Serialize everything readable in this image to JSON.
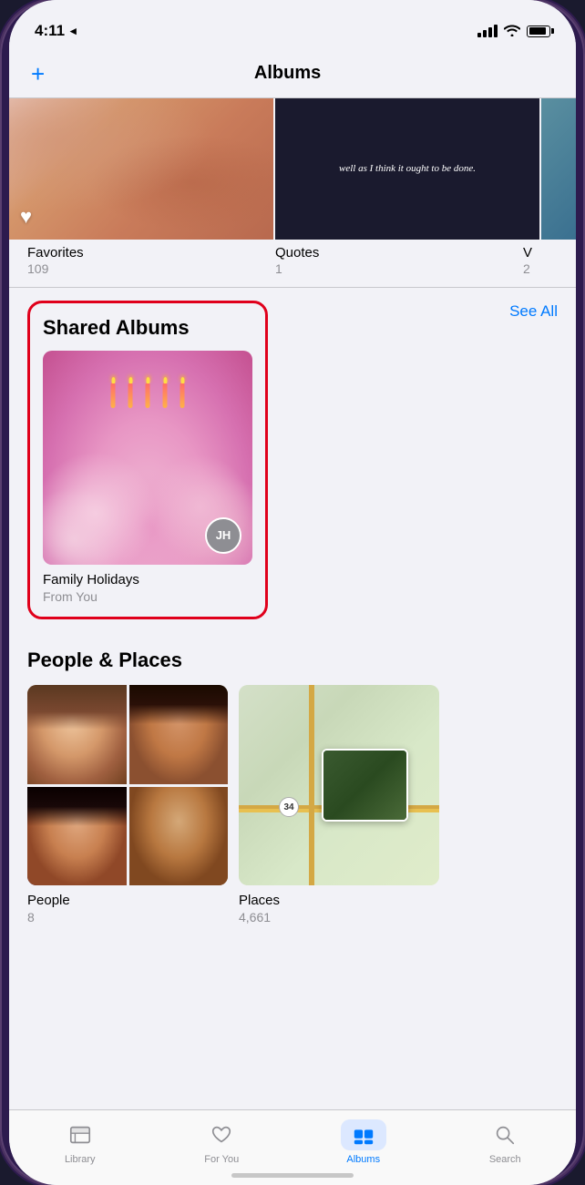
{
  "device": {
    "time": "4:11",
    "navigation_arrow": "◂"
  },
  "header": {
    "title": "Albums",
    "add_button": "+",
    "back_label": ""
  },
  "top_albums": [
    {
      "name": "Favorites",
      "count": "109",
      "type": "favorites"
    },
    {
      "name": "Quotes",
      "count": "1",
      "type": "quotes"
    },
    {
      "name": "V",
      "count": "2",
      "type": "other"
    }
  ],
  "shared_albums": {
    "section_title": "Shared Albums",
    "see_all_label": "See All",
    "items": [
      {
        "name": "Family Holidays",
        "subtitle": "From You",
        "avatar": "JH"
      }
    ]
  },
  "people_places": {
    "section_title": "People & Places",
    "people_label": "People",
    "people_count": "8",
    "places_label": "Places",
    "places_count": "4,661",
    "map_label": "34"
  },
  "tab_bar": {
    "tabs": [
      {
        "id": "library",
        "label": "Library",
        "active": false
      },
      {
        "id": "for_you",
        "label": "For You",
        "active": false
      },
      {
        "id": "albums",
        "label": "Albums",
        "active": true
      },
      {
        "id": "search",
        "label": "Search",
        "active": false
      }
    ]
  },
  "quotes_text": "well as I think\nit ought to\nbe done.",
  "cake_avatar": "JH"
}
